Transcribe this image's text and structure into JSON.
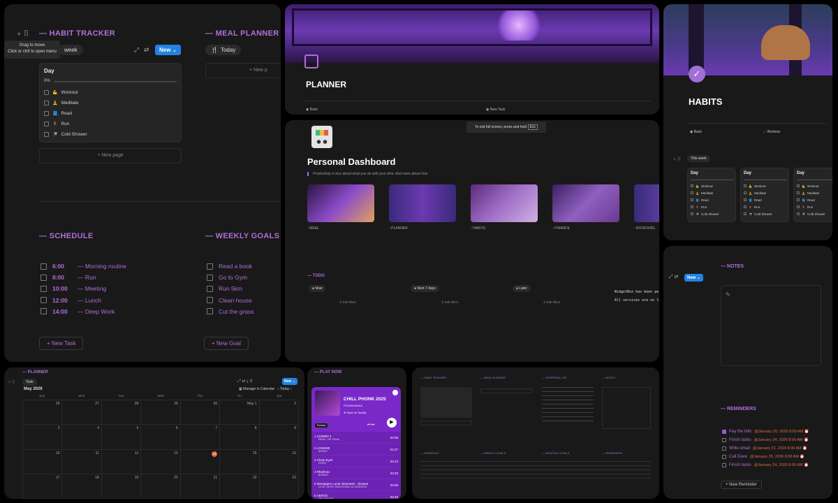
{
  "habit_panel": {
    "tooltip_line1": "Drag to move",
    "tooltip_line2": "Click or ctrl/ to open menu",
    "habit_title": "— HABIT TRACKER",
    "week_chip": "week",
    "new_button": "New",
    "day_card": {
      "title": "Day",
      "progress": "0%",
      "items": [
        "Workout",
        "Meditate",
        "Read",
        "Run",
        "Cold Shower"
      ]
    },
    "new_page": "New page",
    "meal_title": "— MEAL PLANNER",
    "today_chip": "Today",
    "new_p": "New p",
    "schedule_title": "— SCHEDULE",
    "schedule": [
      {
        "time": "6:00",
        "task": "— Morning routine"
      },
      {
        "time": "8:00",
        "task": "— Run"
      },
      {
        "time": "10:00",
        "task": "— Meeting"
      },
      {
        "time": "12:00",
        "task": "— Lunch"
      },
      {
        "time": "14:00",
        "task": "— Deep Work"
      }
    ],
    "new_task": "New Task",
    "goals_title": "— WEEKLY GOALS",
    "goals": [
      "Read a book",
      "Go to Gym",
      "Run 5km",
      "Clean house",
      "Cut the grass"
    ],
    "new_goal": "New Goal"
  },
  "planner_panel": {
    "title": "PLANNER",
    "back": "Back",
    "new_task": "New Task"
  },
  "habits_panel": {
    "title": "HABITS",
    "back": "Back",
    "workout": "Workout",
    "this_week": "This week",
    "day_title": "Day",
    "items": [
      "Workout",
      "Meditate",
      "Read",
      "Run",
      "Cold Shower"
    ]
  },
  "dashboard_panel": {
    "fullscreen_hint": "To exit full screen, press and hold",
    "esc_key": "Esc",
    "title": "Personal Dashboard",
    "quote": "Productivity is less about what you do with your time. And more about how",
    "gallery": [
      "MEAL",
      "PLANNER",
      "HABITS",
      "FINANCE",
      "BOOKSHEL"
    ],
    "todo_title": "— TODO",
    "todo_cols": [
      "Now",
      "Next 7 days",
      "Later"
    ],
    "edit_filters": "Edit filters",
    "console1": "WidgetBox has been permane",
    "console2": "All services are no longer"
  },
  "notes_panel": {
    "new_button": "New",
    "notes_title": "— NOTES",
    "reminders_title": "— REMINDERS",
    "reminders": [
      {
        "text": "Pay the bills",
        "date": "@January 20, 2026 8:00 AM",
        "done": true
      },
      {
        "text": "Finish tasks",
        "date": "@January 24, 2026 8:00 AM",
        "done": false
      },
      {
        "text": "Write email",
        "date": "@January 21, 2024 8:00 AM",
        "done": false
      },
      {
        "text": "Call Dave",
        "date": "@January 25, 2026 8:00 AM",
        "done": false
      },
      {
        "text": "Finish tasks",
        "date": "@January 24, 2026 8:00 AM",
        "done": false
      }
    ],
    "new_reminder": "New Reminder"
  },
  "calendar_panel": {
    "title": "— PLANNER",
    "todo_chip": "Todo",
    "month": "May 2026",
    "new_button": "New",
    "manage": "Manage in Calendar",
    "today": "Today",
    "weekdays": [
      "Sun",
      "Mon",
      "Tue",
      "Wed",
      "Thu",
      "Fri",
      "Sat"
    ],
    "dates": [
      "26",
      "27",
      "28",
      "29",
      "30",
      "May 1",
      "2",
      "3",
      "4",
      "5",
      "6",
      "7",
      "8",
      "9",
      "10",
      "11",
      "12",
      "13",
      "14",
      "15",
      "16",
      "17",
      "18",
      "19",
      "20",
      "21",
      "22",
      "23"
    ]
  },
  "play_panel": {
    "title": "— PLAY NOW",
    "playlist": "CHILL PHONK 2025",
    "artist": "PHONKMANIA",
    "save": "Save on Spotify",
    "preview": "Preview",
    "tracks": [
      {
        "name": "COSMO 2",
        "artist": "PASCL, NK, Phonk",
        "time": "02:05"
      },
      {
        "name": "LONGEE",
        "artist": "ADHALI",
        "time": "01:27"
      },
      {
        "name": "Close Eyes",
        "artist": "DVRST",
        "time": "02:12"
      },
      {
        "name": "Rhythmic",
        "artist": "BLANKO",
        "time": "02:33"
      },
      {
        "name": "Montagem Lunar Diamante - Slowed",
        "artist": "DJ ZK, ANTIS, PASCOTANA, DJ SOSSEGO",
        "time": "03:05"
      },
      {
        "name": "VERÃO",
        "artist": "ONLYPHONK",
        "time": "02:40"
      }
    ]
  },
  "mini_panel": {
    "habit": "— HABIT TRACKER",
    "meal": "— MEAL PLANNER",
    "shopping": "— SHOPPING LIST",
    "notes": "— NOTES",
    "schedule": "— SCHEDULE",
    "weekly": "— WEEKLY GOALS",
    "monthly": "— MONTHLY GOALS",
    "reminders": "— REMINDERS"
  },
  "colors": {
    "accent": "#b06fd6",
    "blue": "#2383e2",
    "panel": "#191919"
  }
}
